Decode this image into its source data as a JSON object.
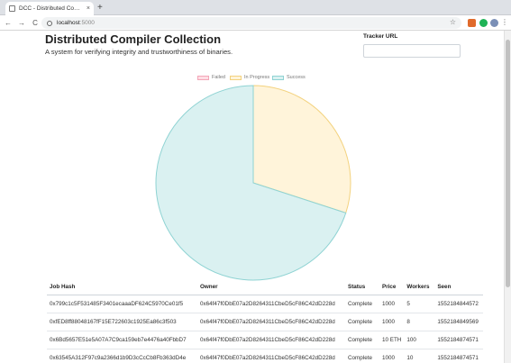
{
  "browser": {
    "tab_title": "DCC - Distributed Compi...",
    "tab_close": "×",
    "new_tab": "+",
    "back": "←",
    "forward": "→",
    "reload": "C",
    "url_host": "localhost",
    "url_port": ":5000",
    "bookmark_star": "☆",
    "menu": "⋮"
  },
  "header": {
    "title": "Distributed Compiler Collection",
    "subtitle": "A system for verifying integrity and trustworthiness of binaries."
  },
  "tracker": {
    "label": "Tracker URL",
    "value": ""
  },
  "chart_data": {
    "type": "pie",
    "categories": [
      "Failed",
      "In Progress",
      "Success"
    ],
    "values": [
      0,
      3,
      7
    ],
    "colors": {
      "Failed": {
        "fill": "#ffdde4",
        "stroke": "#f3a6b8"
      },
      "In Progress": {
        "fill": "#fff4da",
        "stroke": "#f3d27e"
      },
      "Success": {
        "fill": "#daf1f1",
        "stroke": "#8fd3d3"
      }
    },
    "legend_position": "top"
  },
  "table": {
    "headers": [
      "Job Hash",
      "Owner",
      "Status",
      "Price",
      "Workers",
      "Seen"
    ],
    "rows": [
      [
        "0x799c1c5F531485F3401ecaaaDF624C5970Ce01f5",
        "0x64f47f0DbE07a2D8264311CbeD5cF86C42dD228d",
        "Complete",
        "1000",
        "5",
        "1552184844572"
      ],
      [
        "0xfED8ff88048167fF15E722603c1925Ea86c3f503",
        "0x64f47f0DbE07a2D8264311CbeD5cF86C42dD228d",
        "Complete",
        "1000",
        "8",
        "1552184849569"
      ],
      [
        "0x6Bd5657E51e5A07A7C9ca159eb7e4476a40FbbD7",
        "0x64f47f0DbE07a2D8264311CbeD5cF86C42dD228d",
        "Complete",
        "10 ETH",
        "100",
        "1552184874571"
      ],
      [
        "0x63545A312F97c9a2366d1b9D3cCcCb8Fb363dD4e",
        "0x64f47f0DbE07a2D8264311CbeD5cF86C42dD228d",
        "Complete",
        "1000",
        "10",
        "1552184874571"
      ]
    ]
  }
}
